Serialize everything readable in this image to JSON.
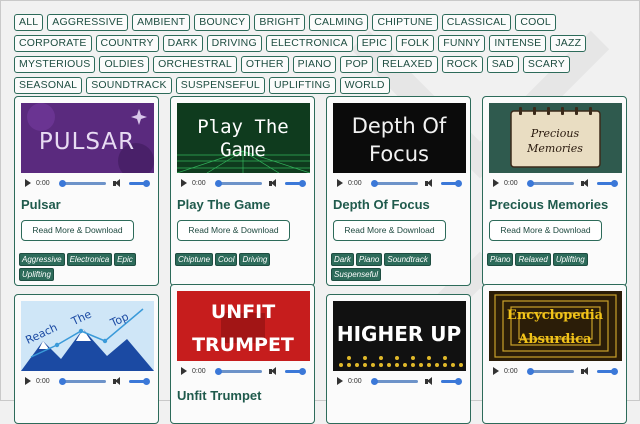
{
  "tags": [
    "ALL",
    "AGGRESSIVE",
    "AMBIENT",
    "BOUNCY",
    "BRIGHT",
    "CALMING",
    "CHIPTUNE",
    "CLASSICAL",
    "COOL",
    "CORPORATE",
    "COUNTRY",
    "DARK",
    "DRIVING",
    "ELECTRONICA",
    "EPIC",
    "FOLK",
    "FUNNY",
    "INTENSE",
    "JAZZ",
    "MYSTERIOUS",
    "OLDIES",
    "ORCHESTRAL",
    "OTHER",
    "PIANO",
    "POP",
    "RELAXED",
    "ROCK",
    "SAD",
    "SCARY",
    "SEASONAL",
    "SOUNDTRACK",
    "SUSPENSEFUL",
    "UPLIFTING",
    "WORLD"
  ],
  "cards": [
    {
      "title": "Pulsar",
      "thumb_text": "PULSAR",
      "time": "0:00",
      "button": "Read More & Download",
      "tags": [
        "Aggressive",
        "Electronica",
        "Epic",
        "Uplifting"
      ]
    },
    {
      "title": "Play The Game",
      "thumb_line1": "Play The",
      "thumb_line2": "Game",
      "time": "0:00",
      "button": "Read More & Download",
      "tags": [
        "Chiptune",
        "Cool",
        "Driving"
      ]
    },
    {
      "title": "Depth Of Focus",
      "thumb_line1": "Depth Of",
      "thumb_line2": "Focus",
      "time": "0:00",
      "button": "Read More & Download",
      "tags": [
        "Dark",
        "Piano",
        "Soundtrack",
        "Suspenseful"
      ]
    },
    {
      "title": "Precious Memories",
      "thumb_line1": "Precious",
      "thumb_line2": "Memories",
      "time": "0:00",
      "button": "Read More & Download",
      "tags": [
        "Piano",
        "Relaxed",
        "Uplifting"
      ]
    },
    {
      "title": "",
      "thumb_line1": "Reach",
      "thumb_line2": "The",
      "thumb_line3": "Top",
      "time": "0:00"
    },
    {
      "title": "Unfit Trumpet",
      "thumb_line1": "UNFIT",
      "thumb_line2": "TRUMPET",
      "time": "0:00"
    },
    {
      "title": "",
      "thumb_text": "HIGHER UP",
      "time": "0:00"
    },
    {
      "title": "",
      "thumb_line1": "Encyclopedia",
      "thumb_line2": "Absurdica",
      "time": "0:00"
    }
  ],
  "colors": {
    "accent": "#2d6b5a",
    "tag_fill": "#2d6b5a",
    "player_blue": "#3b78d8"
  }
}
